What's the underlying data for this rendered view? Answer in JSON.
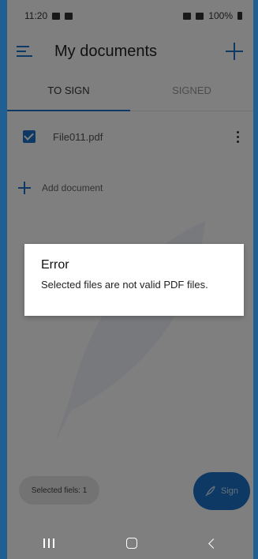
{
  "status_bar": {
    "time": "11:20",
    "battery": "100%"
  },
  "app_bar": {
    "title": "My documents"
  },
  "tabs": [
    {
      "label": "TO SIGN",
      "active": true
    },
    {
      "label": "SIGNED",
      "active": false
    }
  ],
  "documents": [
    {
      "name": "File011.pdf",
      "checked": true
    }
  ],
  "add_document": {
    "label": "Add document"
  },
  "footer": {
    "selected_label": "Selected fiels: 1",
    "sign_label": "Sign"
  },
  "dialog": {
    "title": "Error",
    "message": "Selected files are not valid PDF files."
  },
  "colors": {
    "accent": "#1a73c8",
    "frame": "#1f5f91",
    "overlay": "rgba(0,0,0,0.5)"
  }
}
